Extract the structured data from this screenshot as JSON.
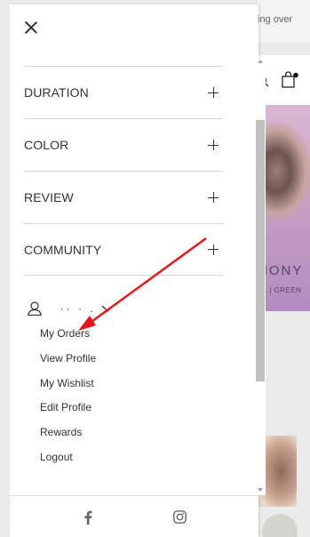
{
  "background": {
    "topbar_text": "ing over",
    "banner_title": "HONY",
    "banner_subtitle": "EL | GREEN"
  },
  "drawer": {
    "close_icon": "close-icon",
    "menu_items": [
      {
        "label": "DURATION",
        "icon": "plus-icon"
      },
      {
        "label": "COLOR",
        "icon": "plus-icon"
      },
      {
        "label": "REVIEW",
        "icon": "plus-icon"
      },
      {
        "label": "COMMUNITY",
        "icon": "plus-icon"
      }
    ],
    "account": {
      "name": "  ·· · .",
      "icon": "user-icon",
      "toggle_icon": "chevron-down-icon",
      "links": [
        "My Orders",
        "View Profile",
        "My Wishlist",
        "Edit Profile",
        "Rewards",
        "Logout"
      ]
    },
    "footer": {
      "icons": [
        "facebook-icon",
        "instagram-icon"
      ]
    }
  },
  "colors": {
    "text": "#333333",
    "divider": "#d4d4d4",
    "annotation": "#e8141a"
  }
}
